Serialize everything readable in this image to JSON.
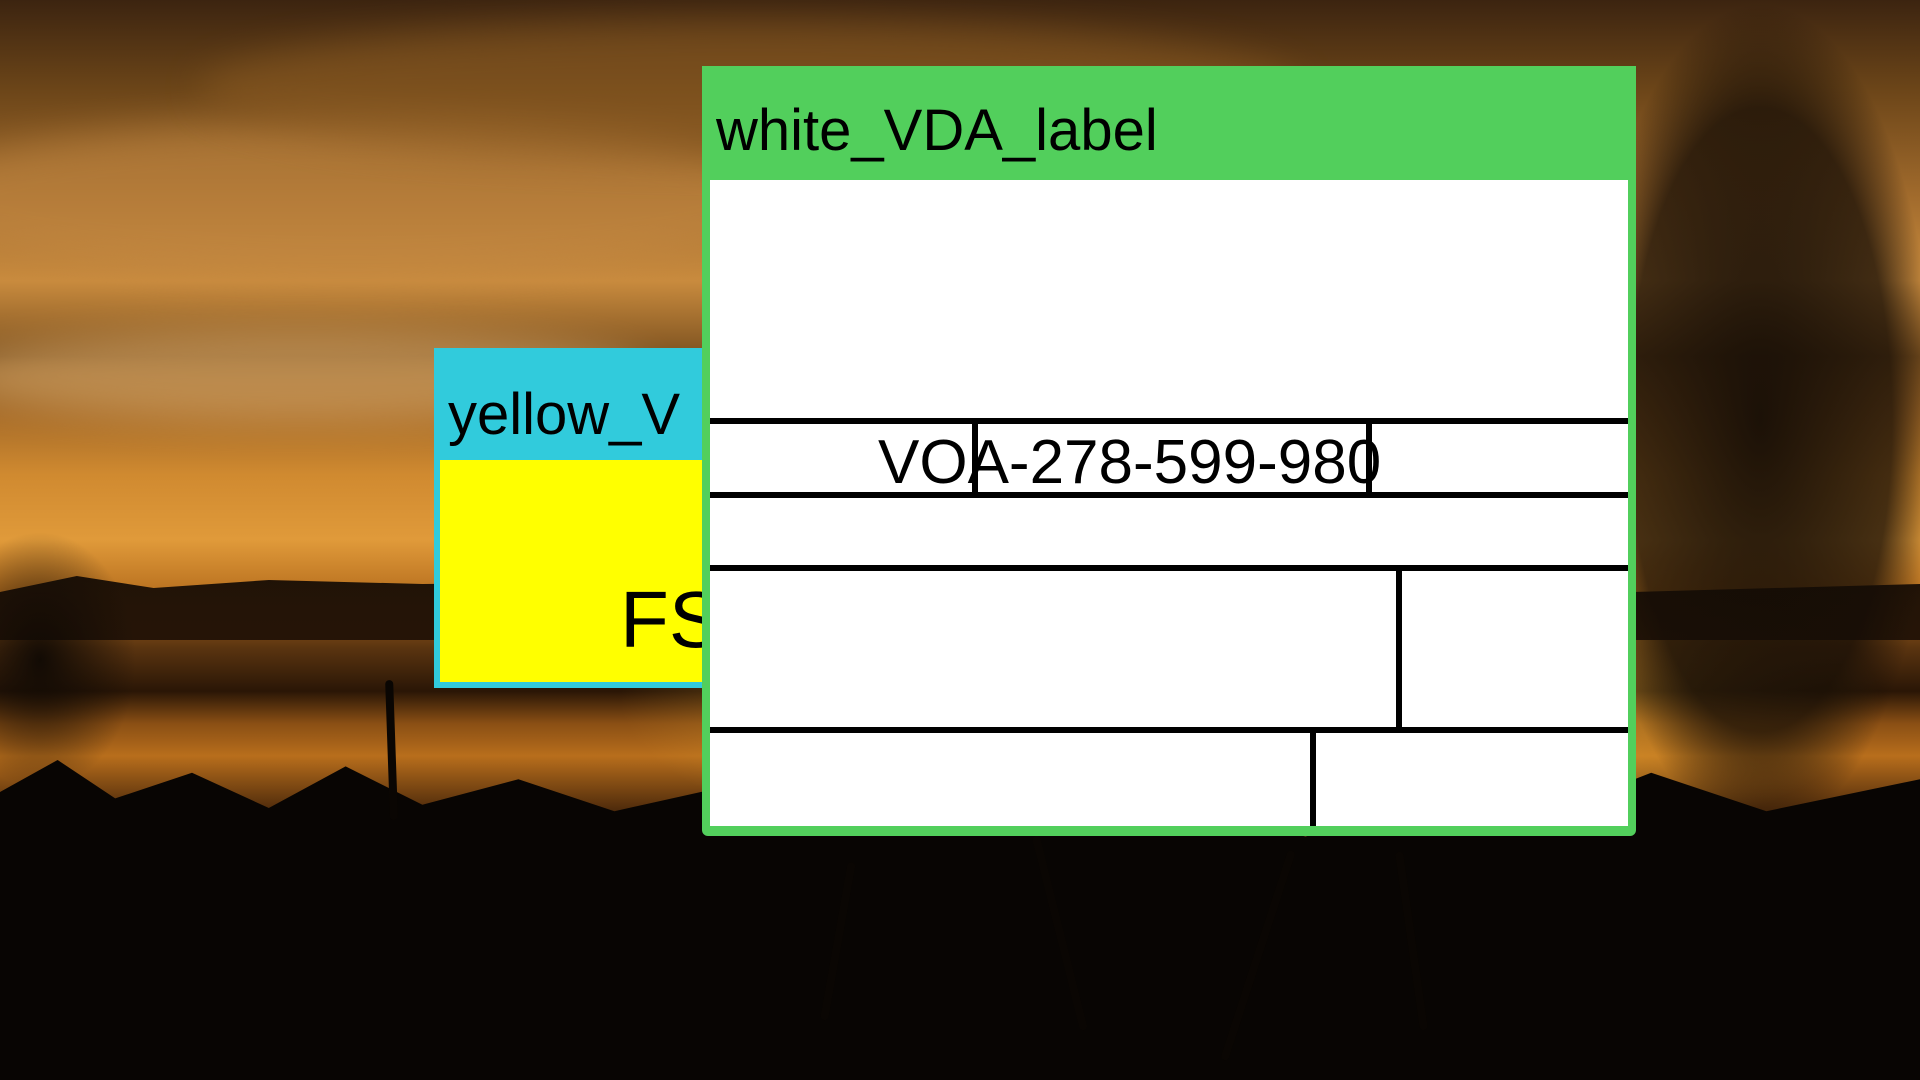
{
  "windows": {
    "yellow": {
      "title": "yellow_V",
      "code_fragment": "FS",
      "frame_color": "#31cbdc",
      "body_color": "#ffff00"
    },
    "white": {
      "title": "white_VDA_label",
      "code": "VOA-278-599-980",
      "frame_color": "#52cf5c",
      "body_color": "#ffffff"
    }
  }
}
